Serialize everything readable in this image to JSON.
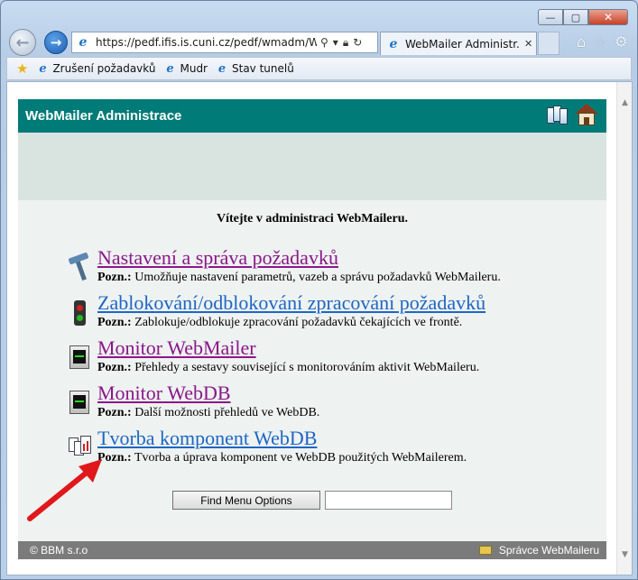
{
  "browser": {
    "address": {
      "url": "https://pedf.ifis.is.cuni.cz/pedf/wmadm/WEE",
      "url_host_highlight": "cuni.cz"
    },
    "tab": {
      "label": "WebMailer Administr..."
    },
    "favorites": [
      {
        "label": "Zrušení požadavků"
      },
      {
        "label": "Mudr"
      },
      {
        "label": "Stav tunelů"
      }
    ]
  },
  "app": {
    "header_title": "WebMailer Administrace",
    "welcome": "Vítejte v administraci WebMaileru.",
    "menu": [
      {
        "title": "Nastavení a správa požadavků",
        "note_label": "Pozn.:",
        "note": "Umožňuje nastavení parametrů, vazeb a správu požadavků WebMaileru.",
        "color": "#8b178a"
      },
      {
        "title": "Zablokování/odblokování zpracování požadavků",
        "note_label": "Pozn.:",
        "note": "Zablokuje/odblokuje zpracování požadavků čekajících ve frontě.",
        "color": "#1e66c5"
      },
      {
        "title": "Monitor WebMailer",
        "note_label": "Pozn.:",
        "note": "Přehledy a sestavy související s monitorováním aktivit WebMaileru.",
        "color": "#8b178a"
      },
      {
        "title": "Monitor WebDB",
        "note_label": "Pozn.:",
        "note": "Další možnosti přehledů ve WebDB.",
        "color": "#8b178a"
      },
      {
        "title": "Tvorba komponent WebDB",
        "note_label": "Pozn.:",
        "note": "Tvorba a úprava komponent ve WebDB použitých WebMailerem.",
        "color": "#1e66c5"
      }
    ],
    "find_button": "Find Menu Options",
    "find_input_value": "",
    "footer": {
      "left": "© BBM s.r.o",
      "right": "Správce WebMaileru"
    }
  },
  "colors": {
    "header_bg": "#007b78",
    "footer_bg": "#7b7b7b",
    "link_visited": "#8b178a",
    "link": "#1e66c5",
    "arrow": "#e0181c"
  }
}
